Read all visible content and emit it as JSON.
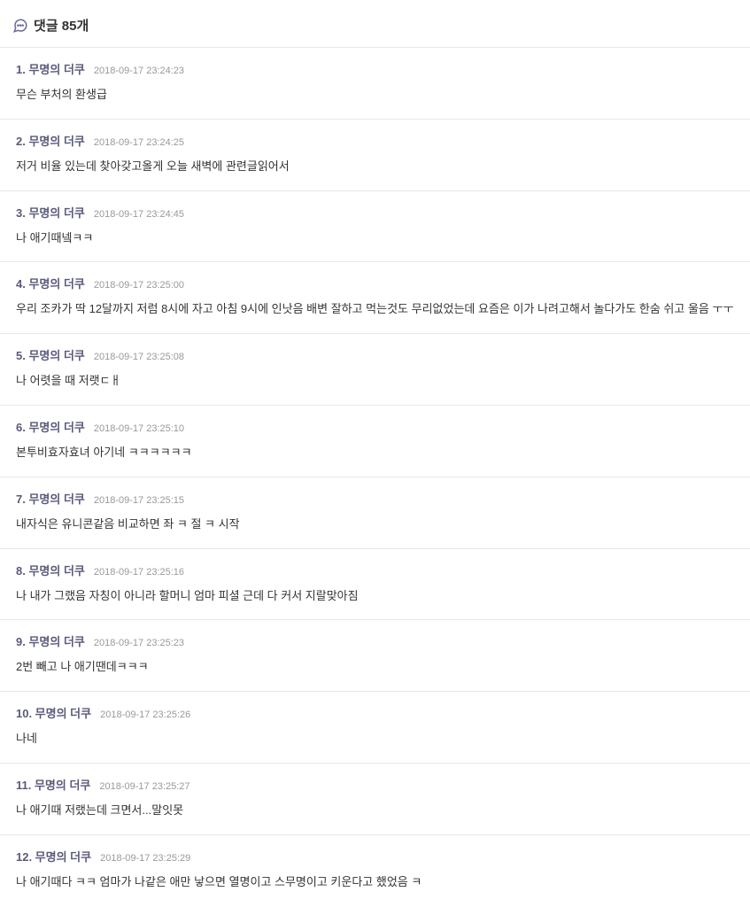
{
  "header": {
    "title_prefix": "댓글",
    "count": "85개"
  },
  "comments": [
    {
      "num": "1",
      "author": "무명의 더쿠",
      "time": "2018-09-17 23:24:23",
      "body": "무슨 부처의 환생급"
    },
    {
      "num": "2",
      "author": "무명의 더쿠",
      "time": "2018-09-17 23:24:25",
      "body": "저거 비율 있는데 찾아갖고올게 오늘 새벽에 관련글읽어서"
    },
    {
      "num": "3",
      "author": "무명의 더쿠",
      "time": "2018-09-17 23:24:45",
      "body": "나 애기때넼ㅋㅋ"
    },
    {
      "num": "4",
      "author": "무명의 더쿠",
      "time": "2018-09-17 23:25:00",
      "body": "우리 조카가 딱 12달까지 저럼 8시에 자고 아침 9시에 인낫음 배변 잘하고 먹는것도 무리없었는데 요즘은 이가 나려고해서 놀다가도 한숨 쉬고 울음 ㅜㅜ"
    },
    {
      "num": "5",
      "author": "무명의 더쿠",
      "time": "2018-09-17 23:25:08",
      "body": "나 어렷을 때 저랫ㄷㅐ"
    },
    {
      "num": "6",
      "author": "무명의 더쿠",
      "time": "2018-09-17 23:25:10",
      "body": "본투비효자효녀 아기네 ㅋㅋㅋㅋㅋㅋ"
    },
    {
      "num": "7",
      "author": "무명의 더쿠",
      "time": "2018-09-17 23:25:15",
      "body": "내자식은 유니콘같음 비교하면 좌 ㅋ 절 ㅋ 시작"
    },
    {
      "num": "8",
      "author": "무명의 더쿠",
      "time": "2018-09-17 23:25:16",
      "body": "나 내가 그랬음 자칭이 아니라 할머니 엄마 피셜 근데 다 커서 지랄맞아짐"
    },
    {
      "num": "9",
      "author": "무명의 더쿠",
      "time": "2018-09-17 23:25:23",
      "body": "2번 빼고 나 애기땐데ㅋㅋㅋ"
    },
    {
      "num": "10",
      "author": "무명의 더쿠",
      "time": "2018-09-17 23:25:26",
      "body": "나네"
    },
    {
      "num": "11",
      "author": "무명의 더쿠",
      "time": "2018-09-17 23:25:27",
      "body": "나 애기때 저랬는데 크면서...말잇못"
    },
    {
      "num": "12",
      "author": "무명의 더쿠",
      "time": "2018-09-17 23:25:29",
      "body": "나 애기때다 ㅋㅋ 엄마가 나같은 애만 낳으면 열명이고 스무명이고 키운다고 했었음 ㅋ"
    }
  ]
}
